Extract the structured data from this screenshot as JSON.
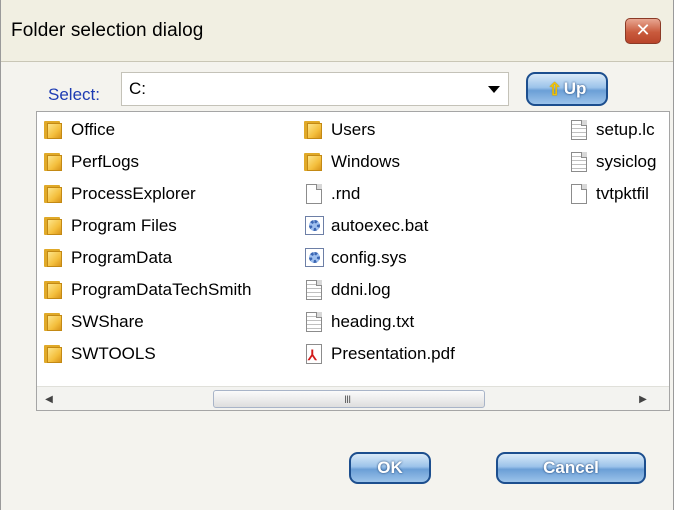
{
  "window": {
    "title": "Folder selection dialog",
    "close_glyph": "✕"
  },
  "select": {
    "label": "Select:",
    "value": "C:"
  },
  "up_button": {
    "arrow": "⇧",
    "label": "Up"
  },
  "files": {
    "columns": [
      [
        {
          "name": "Office",
          "icon": "folder-icon"
        },
        {
          "name": "PerfLogs",
          "icon": "folder-icon"
        },
        {
          "name": "ProcessExplorer",
          "icon": "folder-icon"
        },
        {
          "name": "Program Files",
          "icon": "folder-icon"
        },
        {
          "name": "ProgramData",
          "icon": "folder-icon"
        },
        {
          "name": "ProgramDataTechSmith",
          "icon": "folder-icon"
        },
        {
          "name": "SWShare",
          "icon": "folder-icon"
        },
        {
          "name": "SWTOOLS",
          "icon": "folder-icon"
        }
      ],
      [
        {
          "name": "Users",
          "icon": "folder-icon"
        },
        {
          "name": "Windows",
          "icon": "folder-icon"
        },
        {
          "name": ".rnd",
          "icon": "blank-file-icon"
        },
        {
          "name": "autoexec.bat",
          "icon": "batch-file-icon"
        },
        {
          "name": "config.sys",
          "icon": "system-file-icon"
        },
        {
          "name": "ddni.log",
          "icon": "text-file-icon"
        },
        {
          "name": "heading.txt",
          "icon": "text-file-icon"
        },
        {
          "name": "Presentation.pdf",
          "icon": "pdf-file-icon"
        }
      ],
      [
        {
          "name": "setup.lc",
          "icon": "text-file-icon"
        },
        {
          "name": "sysiclog",
          "icon": "text-file-icon"
        },
        {
          "name": "tvtpktfil",
          "icon": "blank-file-icon"
        }
      ]
    ]
  },
  "scrollbar": {
    "left_glyph": "◀",
    "right_glyph": "▶",
    "grip": "III"
  },
  "buttons": {
    "ok": "OK",
    "cancel": "Cancel"
  }
}
